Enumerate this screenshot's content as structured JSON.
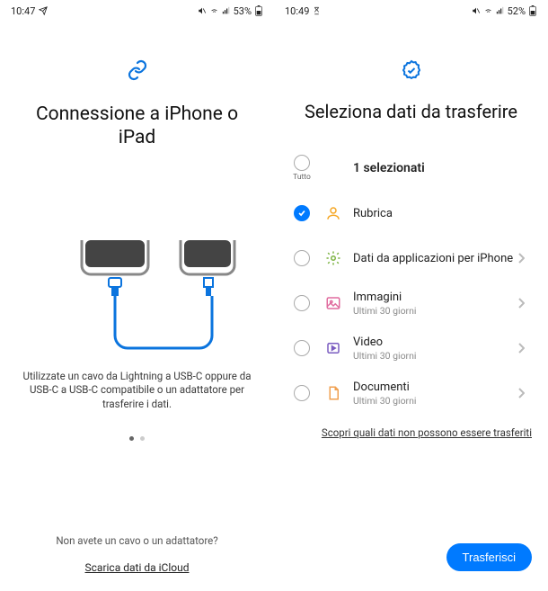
{
  "left": {
    "status": {
      "time": "10:47",
      "battery": "53%"
    },
    "title": "Connessione a iPhone o iPad",
    "instruction": "Utilizzate un cavo da Lightning a USB-C oppure da USB-C a USB-C compatibile o un adattatore per trasferire i dati.",
    "question": "Non avete un cavo o un adattatore?",
    "link": "Scarica dati da iCloud"
  },
  "right": {
    "status": {
      "time": "10:49",
      "battery": "52%"
    },
    "title": "Seleziona dati da trasferire",
    "select_all_label": "Tutto",
    "selected_text": "1 selezionati",
    "items": [
      {
        "title": "Rubrica",
        "sub": "",
        "checked": true,
        "chevron": false,
        "icon": "person"
      },
      {
        "title": "Dati da applicazioni per iPhone",
        "sub": "",
        "checked": false,
        "chevron": true,
        "icon": "gear"
      },
      {
        "title": "Immagini",
        "sub": "Ultimi 30 giorni",
        "checked": false,
        "chevron": true,
        "icon": "image"
      },
      {
        "title": "Video",
        "sub": "Ultimi 30 giorni",
        "checked": false,
        "chevron": true,
        "icon": "video"
      },
      {
        "title": "Documenti",
        "sub": "Ultimi 30 giorni",
        "checked": false,
        "chevron": true,
        "icon": "document"
      }
    ],
    "cannot_transfer_link": "Scopri quali dati non possono essere trasferiti",
    "transfer_button": "Trasferisci"
  },
  "icon_colors": {
    "accent": "#007aff",
    "orange": "#f5a623",
    "green": "#7cb342",
    "pink": "#e06c9f",
    "purple": "#7a5cc0",
    "docorange": "#f0a050"
  }
}
